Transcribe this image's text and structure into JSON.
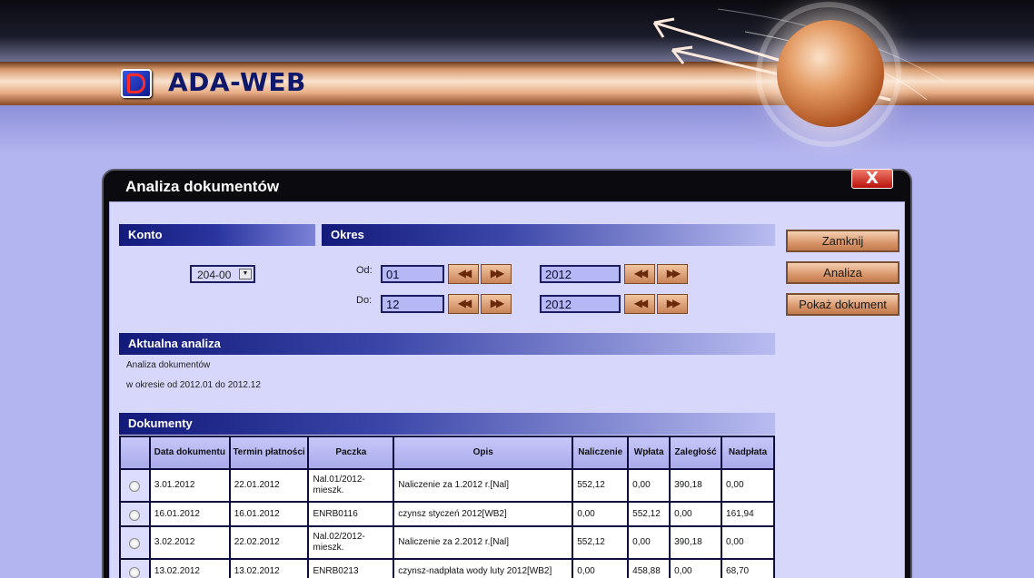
{
  "app": {
    "title": "ADA-WEB"
  },
  "dialog": {
    "title": "Analiza dokumentów",
    "close_label": "X"
  },
  "konto": {
    "header": "Konto",
    "selected": "204-00"
  },
  "okres": {
    "header": "Okres",
    "od_label": "Od:",
    "do_label": "Do:",
    "od_month": "01",
    "od_year": "2012",
    "do_month": "12",
    "do_year": "2012"
  },
  "buttons": {
    "zamknij": "Zamknij",
    "analiza": "Analiza",
    "pokaz": "Pokaż dokument"
  },
  "aktualna": {
    "header": "Aktualna analiza",
    "line1": "Analiza dokumentów",
    "line2": "w okresie od 2012.01 do 2012.12"
  },
  "dokumenty": {
    "header": "Dokumenty",
    "columns": [
      "",
      "Data dokumentu",
      "Termin płatności",
      "Paczka",
      "Opis",
      "Naliczenie",
      "Wpłata",
      "Zaległość",
      "Nadpłata"
    ],
    "rows": [
      [
        "3.01.2012",
        "22.01.2012",
        "Nal.01/2012-mieszk.",
        "Naliczenie za 1.2012 r.[Nal]",
        "552,12",
        "0,00",
        "390,18",
        "0,00"
      ],
      [
        "16.01.2012",
        "16.01.2012",
        "ENRB0116",
        "czynsz styczeń 2012[WB2]",
        "0,00",
        "552,12",
        "0,00",
        "161,94"
      ],
      [
        "3.02.2012",
        "22.02.2012",
        "Nal.02/2012-mieszk.",
        "Naliczenie za 2.2012 r.[Nal]",
        "552,12",
        "0,00",
        "390,18",
        "0,00"
      ],
      [
        "13.02.2012",
        "13.02.2012",
        "ENRB0213",
        "czynsz-nadpłata wody luty 2012[WB2]",
        "0,00",
        "458,88",
        "0,00",
        "68,70"
      ]
    ]
  }
}
